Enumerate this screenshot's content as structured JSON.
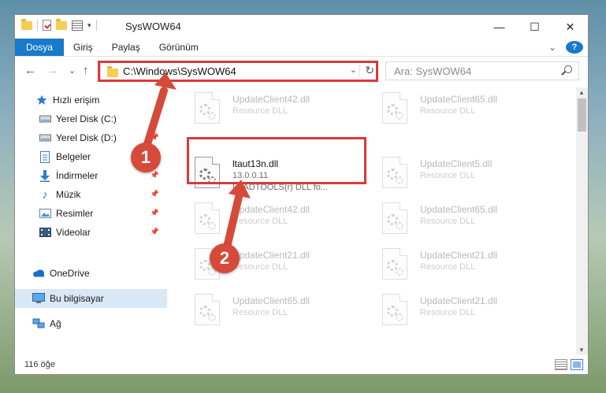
{
  "window": {
    "title": "SysWOW64",
    "controls": {
      "minimize": "—",
      "maximize": "☐",
      "close": "✕"
    }
  },
  "qat": {
    "dropdown": "▾"
  },
  "ribbon": {
    "tabs": [
      {
        "label": "Dosya",
        "active": true
      },
      {
        "label": "Giriş"
      },
      {
        "label": "Paylaş"
      },
      {
        "label": "Görünüm"
      }
    ],
    "expand_icon": "⌄",
    "help_icon": "?"
  },
  "nav": {
    "back": "←",
    "forward": "→",
    "recent": "⌄",
    "up": "↑",
    "address": "C:\\Windows\\SysWOW64",
    "address_dropdown": "⌄",
    "refresh": "↻",
    "search_placeholder": "Ara: SysWOW64"
  },
  "sidebar": {
    "items": [
      {
        "label": "Hızlı erişim",
        "icon": "star-icon"
      },
      {
        "label": "Yerel Disk (C:)",
        "icon": "drive-icon",
        "pinned": true
      },
      {
        "label": "Yerel Disk (D:)",
        "icon": "drive-icon",
        "pinned": true
      },
      {
        "label": "Belgeler",
        "icon": "document-icon",
        "pinned": true
      },
      {
        "label": "İndirmeler",
        "icon": "download-icon",
        "pinned": true
      },
      {
        "label": "Müzik",
        "icon": "music-icon",
        "pinned": true
      },
      {
        "label": "Resimler",
        "icon": "pictures-icon",
        "pinned": true
      },
      {
        "label": "Videolar",
        "icon": "videos-icon",
        "pinned": true
      },
      {
        "label": "OneDrive",
        "icon": "cloud-icon"
      },
      {
        "label": "Bu bilgisayar",
        "icon": "computer-icon",
        "selected": true
      },
      {
        "label": "Ağ",
        "icon": "network-icon"
      }
    ]
  },
  "files": {
    "left": [
      {
        "name": "UpdateClient42.dll",
        "sub": "Resource DLL"
      },
      {
        "name": "ltaut13n.dll",
        "sub": "13.0.0.11",
        "sub2": "LEADTOOLS(r) DLL fo...",
        "focus": true
      },
      {
        "name": "UpdateClient42.dll",
        "sub": "Resource DLL"
      },
      {
        "name": "UpdateClient21.dll",
        "sub": "Resource DLL"
      },
      {
        "name": "UpdateClient65.dll",
        "sub": "Resource DLL"
      }
    ],
    "right": [
      {
        "name": "UpdateClient65.dll",
        "sub": "Resource DLL"
      },
      {
        "name": "UpdateClient5.dll",
        "sub": "Resource DLL"
      },
      {
        "name": "UpdateClient65.dll",
        "sub": "Resource DLL"
      },
      {
        "name": "UpdateClient21.dll",
        "sub": "Resource DLL"
      },
      {
        "name": "UpdateClient21.dll",
        "sub": "Resource DLL"
      }
    ]
  },
  "status": {
    "count": "116 öğe"
  },
  "annotations": {
    "step1": "1",
    "step2": "2",
    "color": "#d64a3a"
  },
  "scroll": {
    "up": "▲",
    "down": "▼"
  }
}
